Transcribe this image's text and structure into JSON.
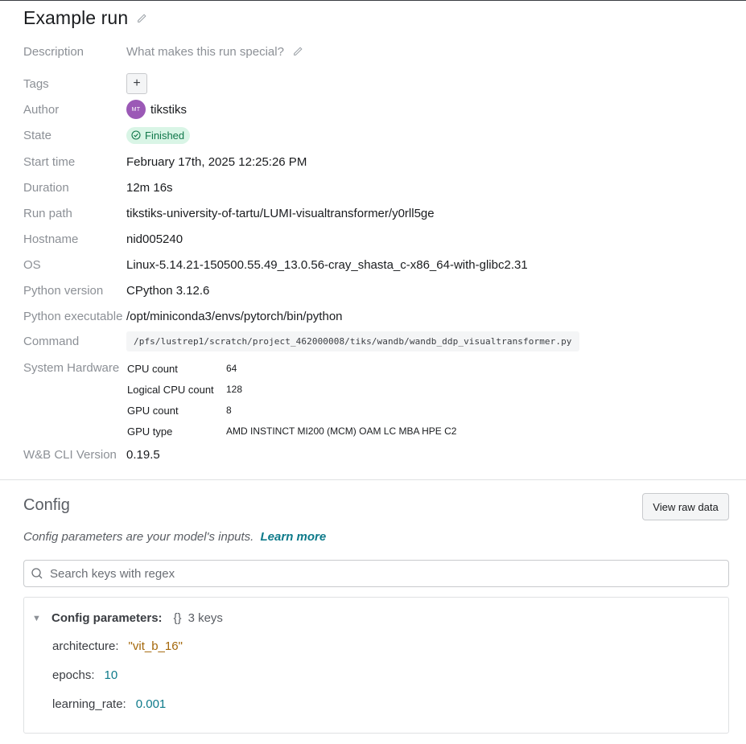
{
  "header": {
    "title": "Example run"
  },
  "overview": {
    "description": {
      "label": "Description",
      "placeholder": "What makes this run special?"
    },
    "tags": {
      "label": "Tags",
      "add": "+"
    },
    "author": {
      "label": "Author",
      "initials": "MT",
      "name": "tikstiks",
      "avatar_color": "#9b59b6"
    },
    "state": {
      "label": "State",
      "value": "Finished",
      "color": "#10774a"
    },
    "start_time": {
      "label": "Start time",
      "value": "February 17th, 2025 12:25:26 PM"
    },
    "duration": {
      "label": "Duration",
      "value": "12m 16s"
    },
    "run_path": {
      "label": "Run path",
      "value": "tikstiks-university-of-tartu/LUMI-visualtransformer/y0rll5ge"
    },
    "hostname": {
      "label": "Hostname",
      "value": "nid005240"
    },
    "os": {
      "label": "OS",
      "value": "Linux-5.14.21-150500.55.49_13.0.56-cray_shasta_c-x86_64-with-glibc2.31"
    },
    "python_version": {
      "label": "Python version",
      "value": "CPython 3.12.6"
    },
    "python_executable": {
      "label": "Python executable",
      "value": "/opt/miniconda3/envs/pytorch/bin/python"
    },
    "command": {
      "label": "Command",
      "value": "/pfs/lustrep1/scratch/project_462000008/tiks/wandb/wandb_ddp_visualtransformer.py"
    },
    "system_hardware": {
      "label": "System Hardware",
      "items": [
        {
          "key": "CPU count",
          "value": "64"
        },
        {
          "key": "Logical CPU count",
          "value": "128"
        },
        {
          "key": "GPU count",
          "value": "8"
        },
        {
          "key": "GPU type",
          "value": "AMD INSTINCT MI200 (MCM) OAM LC MBA HPE C2"
        }
      ]
    },
    "cli_version": {
      "label": "W&B CLI Version",
      "value": "0.19.5"
    }
  },
  "config": {
    "title": "Config",
    "view_raw": "View raw data",
    "subtitle": "Config parameters are your model's inputs.",
    "learn_more": "Learn more",
    "search_placeholder": "Search keys with regex",
    "panel_title": "Config parameters:",
    "brace": "{}",
    "count": "3 keys",
    "params": [
      {
        "key": "architecture:",
        "value": "\"vit_b_16\""
      },
      {
        "key": "epochs:",
        "value": "10"
      },
      {
        "key": "learning_rate:",
        "value": "0.001"
      }
    ]
  }
}
